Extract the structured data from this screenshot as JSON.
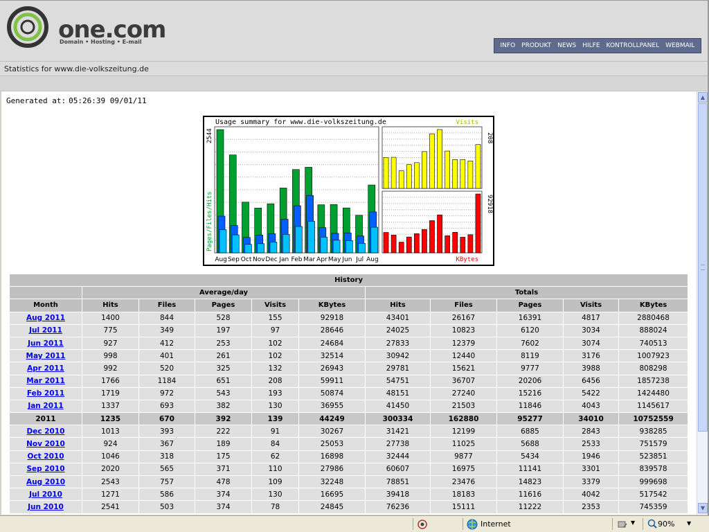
{
  "site": {
    "logo_text": "one.com",
    "logo_tagline": "Domain • Hosting • E-mail",
    "nav": [
      "INFO",
      "PRODUKT",
      "NEWS",
      "HILFE",
      "KONTROLLPANEL",
      "WEBMAIL"
    ]
  },
  "headline": "Statistics for www.die-volkszeitung.de",
  "generated": {
    "label": "Generated at:",
    "value": "05:26:39 09/01/11"
  },
  "chart_data": {
    "type": "bar",
    "title": "Usage summary for www.die-volkszeitung.de",
    "categories": [
      "Aug",
      "Sep",
      "Oct",
      "Nov",
      "Dec",
      "Jan",
      "Feb",
      "Mar",
      "Apr",
      "May",
      "Jun",
      "Jul",
      "Aug"
    ],
    "left_panel": {
      "label": "Pages/Files/Hits",
      "max_label": "2544",
      "ylim": [
        0,
        2544
      ],
      "series": [
        {
          "name": "Hits",
          "color": "#00a030",
          "values": [
            2543,
            2020,
            1046,
            924,
            1013,
            1337,
            1719,
            1766,
            992,
            998,
            927,
            775,
            1400
          ]
        },
        {
          "name": "Files",
          "color": "#0060ff",
          "values": [
            757,
            565,
            318,
            367,
            393,
            693,
            972,
            1184,
            520,
            401,
            412,
            349,
            844
          ]
        },
        {
          "name": "Pages",
          "color": "#00c0ff",
          "values": [
            478,
            371,
            175,
            189,
            222,
            382,
            543,
            651,
            325,
            261,
            253,
            197,
            528
          ]
        }
      ]
    },
    "visits_panel": {
      "label": "Visits",
      "max_label": "208",
      "ylim": [
        0,
        208
      ],
      "series": [
        {
          "name": "Visits",
          "color": "#ffff00",
          "values": [
            109,
            110,
            62,
            84,
            91,
            130,
            193,
            208,
            132,
            102,
            102,
            97,
            155
          ]
        }
      ]
    },
    "kbytes_panel": {
      "label": "KBytes",
      "max_label": "92918",
      "ylim": [
        0,
        92918
      ],
      "series": [
        {
          "name": "KBytes",
          "color": "#ff0000",
          "values": [
            32248,
            27986,
            16898,
            25053,
            30267,
            36955,
            50874,
            59911,
            26943,
            32514,
            24684,
            28646,
            92918
          ]
        }
      ]
    }
  },
  "history": {
    "title": "History",
    "group_avg": "Average/day",
    "group_totals": "Totals",
    "columns": [
      "Month",
      "Hits",
      "Files",
      "Pages",
      "Visits",
      "KBytes",
      "Hits",
      "Files",
      "Pages",
      "Visits",
      "KBytes"
    ],
    "rows": [
      {
        "month": "Aug 2011",
        "link": true,
        "cells": [
          "1400",
          "844",
          "528",
          "155",
          "92918",
          "43401",
          "26167",
          "16391",
          "4817",
          "2880468"
        ]
      },
      {
        "month": "Jul 2011",
        "link": true,
        "cells": [
          "775",
          "349",
          "197",
          "97",
          "28646",
          "24025",
          "10823",
          "6120",
          "3034",
          "888024"
        ]
      },
      {
        "month": "Jun 2011",
        "link": true,
        "cells": [
          "927",
          "412",
          "253",
          "102",
          "24684",
          "27833",
          "12379",
          "7602",
          "3074",
          "740513"
        ]
      },
      {
        "month": "May 2011",
        "link": true,
        "cells": [
          "998",
          "401",
          "261",
          "102",
          "32514",
          "30942",
          "12440",
          "8119",
          "3176",
          "1007923"
        ]
      },
      {
        "month": "Apr 2011",
        "link": true,
        "cells": [
          "992",
          "520",
          "325",
          "132",
          "26943",
          "29781",
          "15621",
          "9777",
          "3988",
          "808298"
        ]
      },
      {
        "month": "Mar 2011",
        "link": true,
        "cells": [
          "1766",
          "1184",
          "651",
          "208",
          "59911",
          "54751",
          "36707",
          "20206",
          "6456",
          "1857238"
        ]
      },
      {
        "month": "Feb 2011",
        "link": true,
        "cells": [
          "1719",
          "972",
          "543",
          "193",
          "50874",
          "48151",
          "27240",
          "15216",
          "5422",
          "1424480"
        ]
      },
      {
        "month": "Jan 2011",
        "link": true,
        "cells": [
          "1337",
          "693",
          "382",
          "130",
          "36955",
          "41450",
          "21503",
          "11846",
          "4043",
          "1145617"
        ]
      },
      {
        "month": "2011",
        "link": false,
        "cells": [
          "1235",
          "670",
          "392",
          "139",
          "44249",
          "300334",
          "162880",
          "95277",
          "34010",
          "10752559"
        ]
      },
      {
        "month": "Dec 2010",
        "link": true,
        "cells": [
          "1013",
          "393",
          "222",
          "91",
          "30267",
          "31421",
          "12199",
          "6885",
          "2843",
          "938285"
        ]
      },
      {
        "month": "Nov 2010",
        "link": true,
        "cells": [
          "924",
          "367",
          "189",
          "84",
          "25053",
          "27738",
          "11025",
          "5688",
          "2533",
          "751579"
        ]
      },
      {
        "month": "Oct 2010",
        "link": true,
        "cells": [
          "1046",
          "318",
          "175",
          "62",
          "16898",
          "32444",
          "9877",
          "5434",
          "1946",
          "523851"
        ]
      },
      {
        "month": "Sep 2010",
        "link": true,
        "cells": [
          "2020",
          "565",
          "371",
          "110",
          "27986",
          "60607",
          "16975",
          "11141",
          "3301",
          "839578"
        ]
      },
      {
        "month": "Aug 2010",
        "link": true,
        "cells": [
          "2543",
          "757",
          "478",
          "109",
          "32248",
          "78851",
          "23476",
          "14823",
          "3379",
          "999698"
        ]
      },
      {
        "month": "Jul 2010",
        "link": true,
        "cells": [
          "1271",
          "586",
          "374",
          "130",
          "16695",
          "39418",
          "18183",
          "11616",
          "4042",
          "517542"
        ]
      },
      {
        "month": "Jun 2010",
        "link": true,
        "cells": [
          "2541",
          "503",
          "374",
          "78",
          "24845",
          "76236",
          "15111",
          "11222",
          "2353",
          "745359"
        ]
      }
    ]
  },
  "statusbar": {
    "zone": "Internet",
    "zoom": "90%"
  }
}
